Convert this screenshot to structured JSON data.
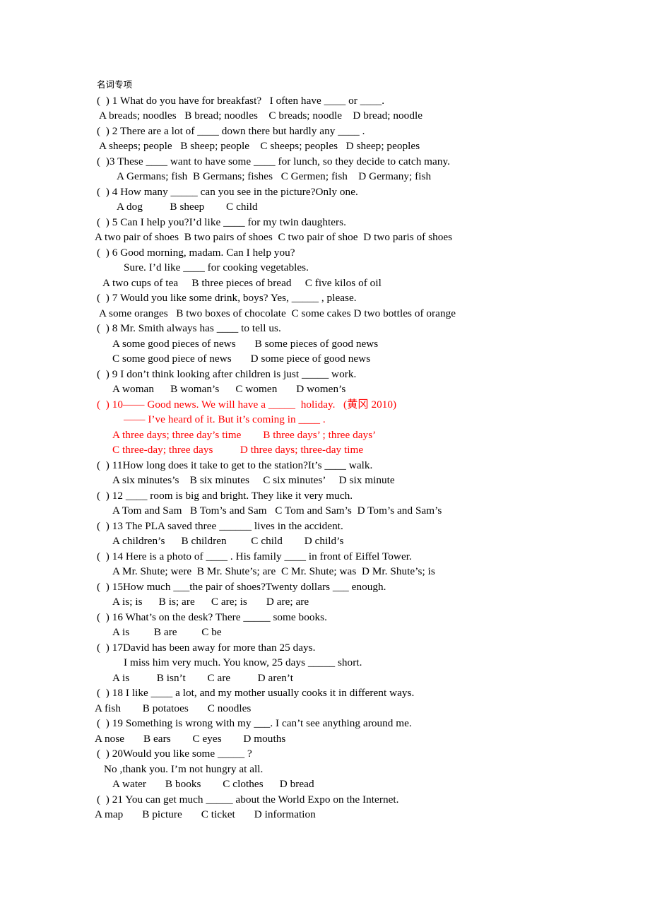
{
  "document": {
    "title": "名词专项",
    "page_background": "#ffffff",
    "text_color": "#000000",
    "highlight_color": "#ff0000",
    "lines": [
      {
        "text": "名词专项",
        "color": "black",
        "indent": "i0",
        "style": "title"
      },
      {
        "text": "(  ) 1 What do you have for breakfast?   I often have ____ or ____.",
        "color": "black",
        "indent": "i0"
      },
      {
        "text": " A breads; noodles   B bread; noodles    C breads; noodle    D bread; noodle",
        "color": "black",
        "indent": "i0"
      },
      {
        "text": "(  ) 2 There are a lot of ____ down there but hardly any ____ .",
        "color": "black",
        "indent": "i0"
      },
      {
        "text": " A sheeps; people   B sheep; people    C sheeps; peoples   D sheep; peoples",
        "color": "black",
        "indent": "i0"
      },
      {
        "text": "(  )3 These ____ want to have some ____ for lunch, so they decide to catch many.",
        "color": "black",
        "indent": "i0"
      },
      {
        "text": "A Germans; fish  B Germans; fishes   C Germen; fish    D Germany; fish",
        "color": "black",
        "indent": "i4"
      },
      {
        "text": "(  ) 4 How many _____ can you see in the picture?Only one.",
        "color": "black",
        "indent": "i0"
      },
      {
        "text": "A dog          B sheep        C child",
        "color": "black",
        "indent": "i4"
      },
      {
        "text": "(  ) 5 Can I help you?I’d like ____ for my twin daughters.",
        "color": "black",
        "indent": "i0"
      },
      {
        "text": "A two pair of shoes  B two pairs of shoes  C two pair of shoe  D two paris of shoes",
        "color": "black",
        "indent": "im1"
      },
      {
        "text": "(  ) 6 Good morning, madam. Can I help you?",
        "color": "black",
        "indent": "i0"
      },
      {
        "text": "Sure. I’d like ____ for cooking vegetables.",
        "color": "black",
        "indent": "i5"
      },
      {
        "text": " A two cups of tea     B three pieces of bread     C five kilos of oil",
        "color": "black",
        "indent": "i1"
      },
      {
        "text": "(  ) 7 Would you like some drink, boys? Yes, _____ , please.",
        "color": "black",
        "indent": "i0"
      },
      {
        "text": " A some oranges   B two boxes of chocolate  C some cakes D two bottles of orange",
        "color": "black",
        "indent": "i0"
      },
      {
        "text": "(  ) 8 Mr. Smith always has ____ to tell us.",
        "color": "black",
        "indent": "i0"
      },
      {
        "text": "A some good pieces of news       B some pieces of good news",
        "color": "black",
        "indent": "i3"
      },
      {
        "text": "C some good piece of news       D some piece of good news",
        "color": "black",
        "indent": "i3"
      },
      {
        "text": "(  ) 9 I don’t think looking after children is just _____ work.",
        "color": "black",
        "indent": "i0"
      },
      {
        "text": "A woman      B woman’s      C women       D women’s",
        "color": "black",
        "indent": "i3"
      },
      {
        "text": "(  ) 10—— Good news. We will have a _____  holiday.   (黄冈 2010)",
        "color": "red",
        "indent": "i0"
      },
      {
        "text": "—— I’ve heard of it. But it’s coming in ____ .",
        "color": "red",
        "indent": "i5"
      },
      {
        "text": "A three days; three day’s time        B three days’ ; three days’",
        "color": "red",
        "indent": "i3"
      },
      {
        "text": "C three-day; three days          D three days; three-day time",
        "color": "red",
        "indent": "i3"
      },
      {
        "text": "(  ) 11How long does it take to get to the station?It’s ____ walk.",
        "color": "black",
        "indent": "i0"
      },
      {
        "text": "A six minutes’s    B six minutes     C six minutes’     D six minute",
        "color": "black",
        "indent": "i3"
      },
      {
        "text": "(  ) 12 ____ room is big and bright. They like it very much.",
        "color": "black",
        "indent": "i0"
      },
      {
        "text": "A Tom and Sam   B Tom’s and Sam   C Tom and Sam’s  D Tom’s and Sam’s",
        "color": "black",
        "indent": "i3"
      },
      {
        "text": "(  ) 13 The PLA saved three ______ lives in the accident.",
        "color": "black",
        "indent": "i0"
      },
      {
        "text": "A children’s      B children         C child        D child’s",
        "color": "black",
        "indent": "i3"
      },
      {
        "text": "(  ) 14 Here is a photo of ____ . His family ____ in front of Eiffel Tower.",
        "color": "black",
        "indent": "i0"
      },
      {
        "text": "A Mr. Shute; were  B Mr. Shute’s; are  C Mr. Shute; was  D Mr. Shute’s; is",
        "color": "black",
        "indent": "i3"
      },
      {
        "text": "(  ) 15How much ___the pair of shoes?Twenty dollars ___ enough.",
        "color": "black",
        "indent": "i0"
      },
      {
        "text": "A is; is      B is; are      C are; is       D are; are",
        "color": "black",
        "indent": "i3"
      },
      {
        "text": "(  ) 16 What’s on the desk? There _____ some books.",
        "color": "black",
        "indent": "i0"
      },
      {
        "text": "A is         B are         C be",
        "color": "black",
        "indent": "i3"
      },
      {
        "text": "(  ) 17David has been away for more than 25 days.",
        "color": "black",
        "indent": "i0"
      },
      {
        "text": "I miss him very much. You know, 25 days _____ short.",
        "color": "black",
        "indent": "i5"
      },
      {
        "text": "A is          B isn’t        C are          D aren’t",
        "color": "black",
        "indent": "i3"
      },
      {
        "text": "(  ) 18 I like ____ a lot, and my mother usually cooks it in different ways.",
        "color": "black",
        "indent": "i0"
      },
      {
        "text": "A fish        B potatoes       C noodles",
        "color": "black",
        "indent": "im1"
      },
      {
        "text": "(  ) 19 Something is wrong with my ___. I can’t see anything around me.",
        "color": "black",
        "indent": "i0"
      },
      {
        "text": "A nose       B ears        C eyes        D mouths",
        "color": "black",
        "indent": "im1"
      },
      {
        "text": "(  ) 20Would you like some _____ ?",
        "color": "black",
        "indent": "i0"
      },
      {
        "text": "No ,thank you. I’m not hungry at all.",
        "color": "black",
        "indent": "i2"
      },
      {
        "text": "A water       B books        C clothes      D bread",
        "color": "black",
        "indent": "i3"
      },
      {
        "text": "(  ) 21 You can get much _____ about the World Expo on the Internet.",
        "color": "black",
        "indent": "i0"
      },
      {
        "text": "A map       B picture       C ticket       D information",
        "color": "black",
        "indent": "im1"
      }
    ]
  }
}
